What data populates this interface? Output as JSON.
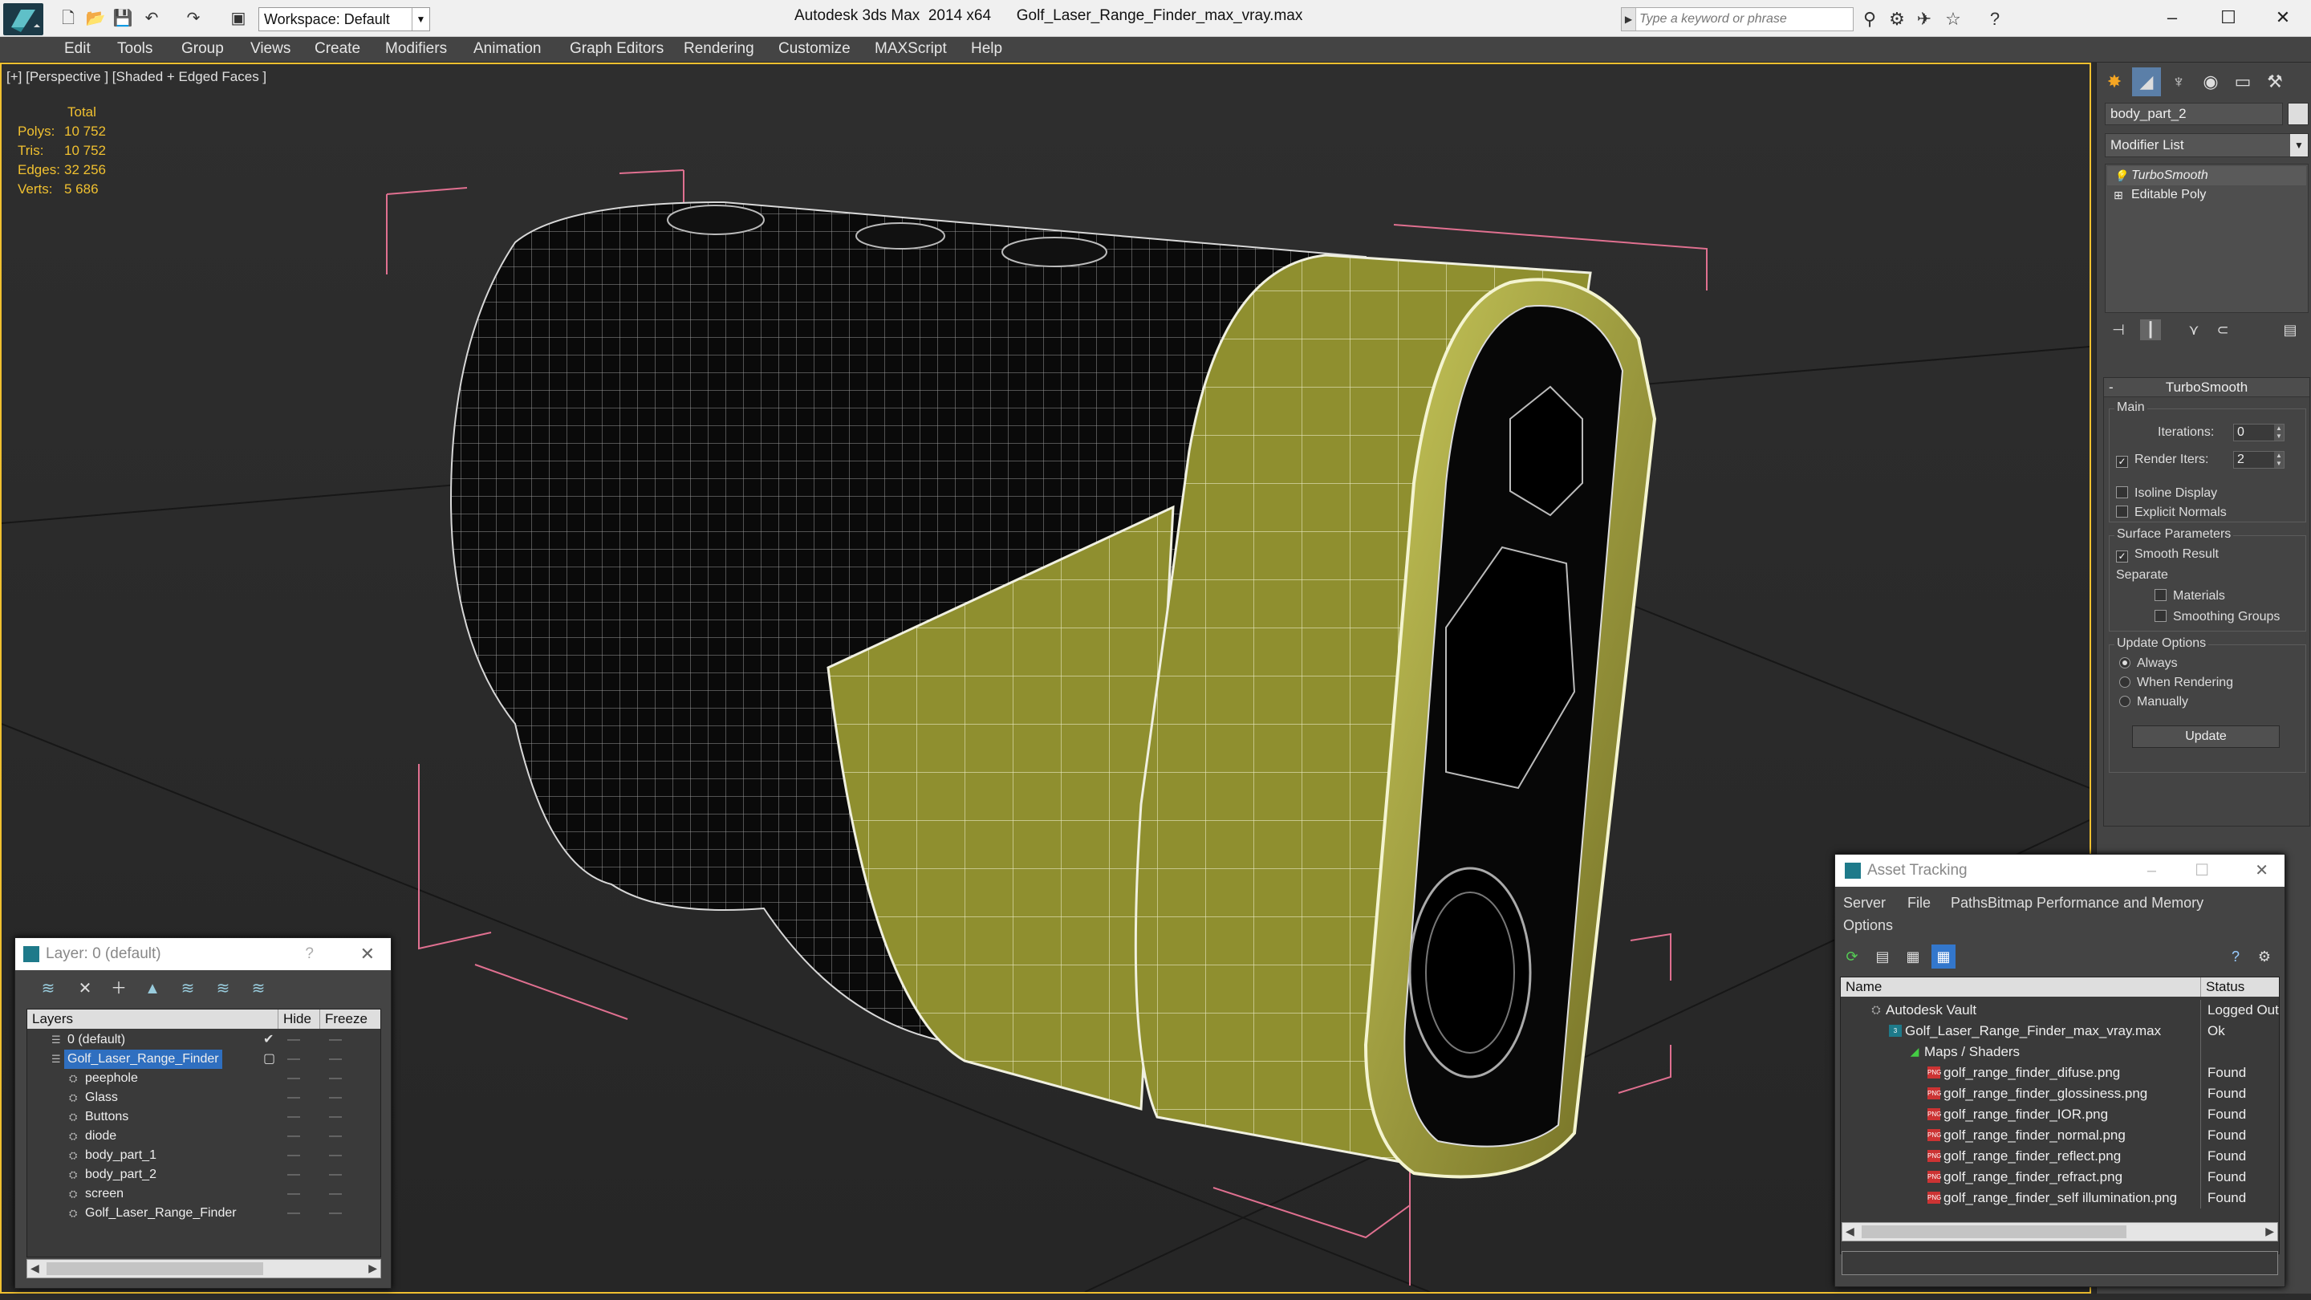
{
  "titlebar": {
    "workspace": "Workspace: Default",
    "app": "Autodesk 3ds Max  2014 x64",
    "file": "Golf_Laser_Range_Finder_max_vray.max",
    "search_placeholder": "Type a keyword or phrase"
  },
  "menu": [
    "Edit",
    "Tools",
    "Group",
    "Views",
    "Create",
    "Modifiers",
    "Animation",
    "Graph Editors",
    "Rendering",
    "Customize",
    "MAXScript",
    "Help"
  ],
  "viewport": {
    "label": "[+] [Perspective ] [Shaded + Edged Faces ]",
    "stats": {
      "header": "Total",
      "rows": [
        {
          "label": "Polys:",
          "value": "10 752"
        },
        {
          "label": "Tris:",
          "value": "10 752"
        },
        {
          "label": "Edges:",
          "value": "32 256"
        },
        {
          "label": "Verts:",
          "value": "5 686"
        }
      ]
    }
  },
  "command_panel": {
    "object_name": "body_part_2",
    "modifier_list": "Modifier List",
    "stack": [
      "TurboSmooth",
      "Editable Poly"
    ],
    "turbosmooth": {
      "title": "TurboSmooth",
      "main_group": "Main",
      "iterations_label": "Iterations:",
      "iterations": "0",
      "render_iters_label": "Render Iters:",
      "render_iters": "2",
      "isoline": "Isoline Display",
      "explicit": "Explicit Normals",
      "surface_group": "Surface Parameters",
      "smooth_result": "Smooth Result",
      "separate": "Separate",
      "materials": "Materials",
      "smoothing_groups": "Smoothing Groups",
      "update_group": "Update Options",
      "always": "Always",
      "when_rendering": "When Rendering",
      "manually": "Manually",
      "update_button": "Update"
    }
  },
  "layer_dialog": {
    "title": "Layer: 0 (default)",
    "help": "?",
    "columns": [
      "Layers",
      "Hide",
      "Freeze"
    ],
    "rows": [
      {
        "name": "0 (default)",
        "level": 0
      },
      {
        "name": "Golf_Laser_Range_Finder",
        "level": 0
      },
      {
        "name": "peephole",
        "level": 1
      },
      {
        "name": "Glass",
        "level": 1
      },
      {
        "name": "Buttons",
        "level": 1
      },
      {
        "name": "diode",
        "level": 1
      },
      {
        "name": "body_part_1",
        "level": 1
      },
      {
        "name": "body_part_2",
        "level": 1
      },
      {
        "name": "screen",
        "level": 1
      },
      {
        "name": "Golf_Laser_Range_Finder",
        "level": 1
      }
    ]
  },
  "asset_dialog": {
    "title": "Asset Tracking",
    "menu": [
      "Server",
      "File",
      "Paths",
      "Bitmap Performance and Memory",
      "Options"
    ],
    "columns": [
      "Name",
      "Status"
    ],
    "rows": [
      {
        "name": "Autodesk Vault",
        "status": "Logged Out",
        "level": 0,
        "icon": "vault"
      },
      {
        "name": "Golf_Laser_Range_Finder_max_vray.max",
        "status": "Ok",
        "level": 1,
        "icon": "max"
      },
      {
        "name": "Maps / Shaders",
        "status": "",
        "level": 2,
        "icon": "maps"
      },
      {
        "name": "golf_range_finder_difuse.png",
        "status": "Found",
        "level": 3,
        "icon": "png"
      },
      {
        "name": "golf_range_finder_glossiness.png",
        "status": "Found",
        "level": 3,
        "icon": "png"
      },
      {
        "name": "golf_range_finder_IOR.png",
        "status": "Found",
        "level": 3,
        "icon": "png"
      },
      {
        "name": "golf_range_finder_normal.png",
        "status": "Found",
        "level": 3,
        "icon": "png"
      },
      {
        "name": "golf_range_finder_reflect.png",
        "status": "Found",
        "level": 3,
        "icon": "png"
      },
      {
        "name": "golf_range_finder_refract.png",
        "status": "Found",
        "level": 3,
        "icon": "png"
      },
      {
        "name": "golf_range_finder_self illumination.png",
        "status": "Found",
        "level": 3,
        "icon": "png"
      }
    ]
  }
}
